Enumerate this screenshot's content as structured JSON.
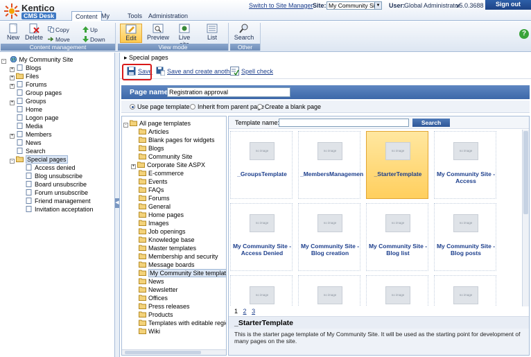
{
  "header": {
    "brand_name": "Kentico",
    "brand_sub": "CMS Desk",
    "tabs": [
      {
        "label": "Content",
        "active": true
      },
      {
        "label": "My desk",
        "active": false
      },
      {
        "label": "Tools",
        "active": false
      },
      {
        "label": "Administration",
        "active": false
      }
    ],
    "switch_link": "Switch to Site Manager",
    "site_label": "Site:",
    "site_value": "My Community Site",
    "user_label": "User:",
    "user_value": "Global Administrator",
    "version": "v5.0.3688",
    "signout_label": "Sign out"
  },
  "ribbon": {
    "content_management": {
      "group_label": "Content management",
      "new": "New",
      "delete": "Delete",
      "copy": "Copy",
      "move": "Move",
      "up": "Up",
      "down": "Down"
    },
    "view_mode": {
      "group_label": "View mode",
      "edit": "Edit",
      "preview": "Preview",
      "live_site": "Live site",
      "list": "List"
    },
    "other": {
      "group_label": "Other",
      "search": "Search"
    },
    "help_icon": "?"
  },
  "tree": {
    "root": "My Community Site",
    "items": [
      {
        "label": "Blogs",
        "expand": "+"
      },
      {
        "label": "Files",
        "expand": "+"
      },
      {
        "label": "Forums",
        "expand": "+"
      },
      {
        "label": "Group pages",
        "expand": ""
      },
      {
        "label": "Groups",
        "expand": "+"
      },
      {
        "label": "Home",
        "expand": ""
      },
      {
        "label": "Logon page",
        "expand": ""
      },
      {
        "label": "Media",
        "expand": ""
      },
      {
        "label": "Members",
        "expand": "+"
      },
      {
        "label": "News",
        "expand": ""
      },
      {
        "label": "Search",
        "expand": ""
      },
      {
        "label": "Special pages",
        "expand": "-"
      }
    ],
    "children": [
      "Access denied",
      "Blog unsubscribe",
      "Board unsubscribe",
      "Forum unsubscribe",
      "Friend management",
      "Invitation acceptation"
    ]
  },
  "main": {
    "breadcrumb": "Special pages",
    "save": "Save",
    "save_create": "Save and create another",
    "spell_check": "Spell check",
    "page_name_label": "Page name:",
    "page_name_value": "Registration approval",
    "radio_use": "Use page template",
    "radio_inherit": "Inherit from parent page",
    "radio_blank": "Create a blank page",
    "categories_root": "All page templates",
    "categories": [
      "Articles",
      "Blank pages for widgets",
      "Blogs",
      "Community Site",
      "Corporate Site ASPX",
      "E-commerce",
      "Events",
      "FAQs",
      "Forums",
      "General",
      "Home pages",
      "Images",
      "Job openings",
      "Knowledge base",
      "Master templates",
      "Membership and security",
      "Message boards",
      "My Community Site templates",
      "News",
      "Newsletter",
      "Offices",
      "Press releases",
      "Products",
      "Templates with editable regio",
      "Wiki"
    ],
    "template_name_label": "Template name:",
    "search_button": "Search",
    "no_image": "no image",
    "templates": [
      "_GroupsTemplate",
      "_MembersManagemen",
      "_StarterTemplate",
      "My Community Site - Access",
      "My Community Site - Access Denied",
      "My Community Site - Blog creation",
      "My Community Site - Blog list",
      "My Community Site - Blog posts"
    ],
    "pages": [
      "1",
      "2",
      "3"
    ],
    "selected_title": "_StarterTemplate",
    "selected_desc": "This is the starter page template of My Community Site. It will be used as the starting point for development of many pages on the site."
  },
  "colors": {
    "accent": "#3d68a9",
    "selected": "#ffcf5e",
    "highlight": "#d81818"
  }
}
